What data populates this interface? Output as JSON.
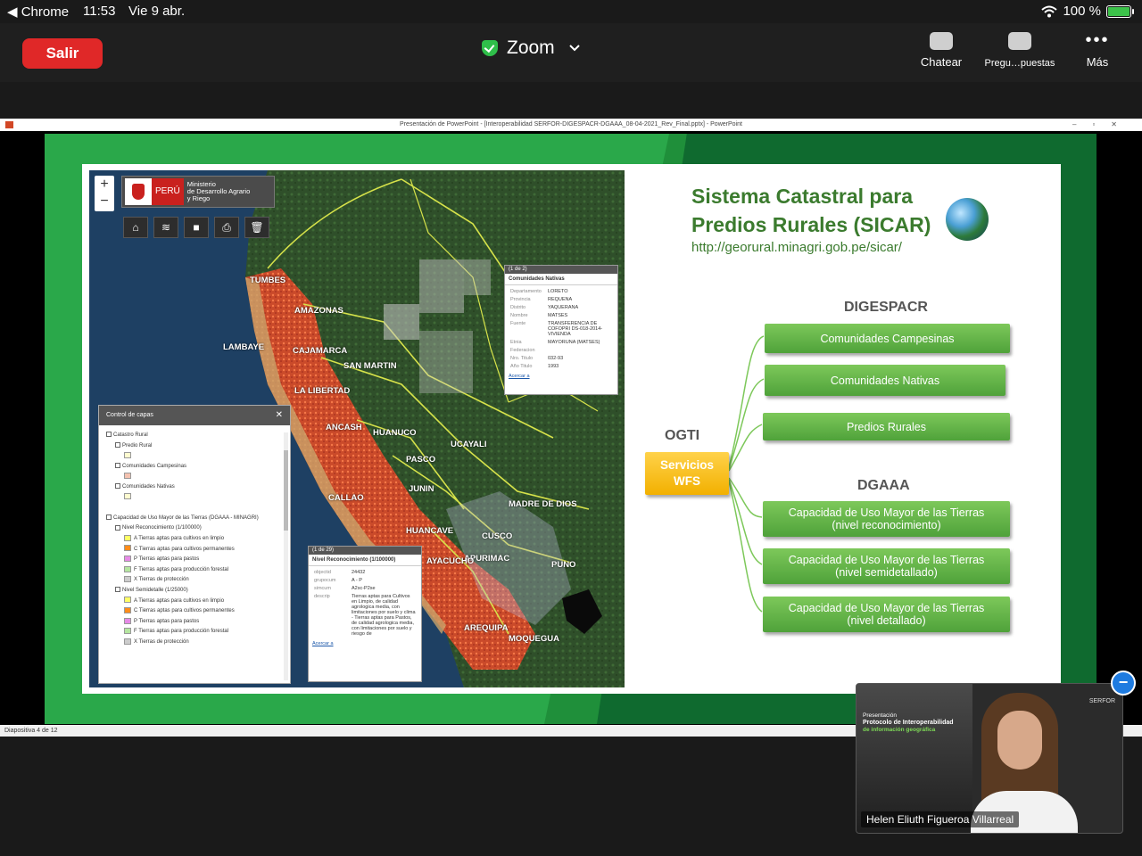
{
  "status_bar": {
    "back_app": "◀ Chrome",
    "time": "11:53",
    "date": "Vie 9 abr.",
    "wifi_icon": "wifi-icon",
    "battery": "100 %",
    "battery_level": 100
  },
  "zoom_bar": {
    "leave_label": "Salir",
    "title": "Zoom",
    "chat_label": "Chatear",
    "qa_label": "Pregu…puestas",
    "more_label": "Más"
  },
  "powerpoint": {
    "window_title": "Presentación de PowerPoint - [Interoperabilidad SERFOR-DIGESPACR-DGAAA_08-04-2021_Rev_Final.pptx] - PowerPoint",
    "status": "Diapositiva 4 de 12"
  },
  "slide": {
    "title_line1": "Sistema Catastral para",
    "title_line2": "Predios Rurales (SICAR)",
    "url": "http://georural.minagri.gob.pe/sicar/",
    "digespacr_label": "DIGESPACR",
    "dgaaa_label": "DGAAA",
    "ogti_label": "OGTI",
    "wfs_line1": "Servicios",
    "wfs_line2": "WFS",
    "digespacr_items": [
      "Comunidades Campesinas",
      "Comunidades Nativas",
      "Predios Rurales"
    ],
    "dgaaa_items": [
      [
        "Capacidad de Uso Mayor de las Tierras",
        "(nivel reconocimiento)"
      ],
      [
        "Capacidad de Uso Mayor de las Tierras",
        "(nivel semidetallado)"
      ],
      [
        "Capacidad de Uso Mayor de las Tierras",
        "(nivel detallado)"
      ]
    ],
    "colors": {
      "green": "#4fa23a",
      "yellow": "#f2b000",
      "title": "#3b7b2e"
    }
  },
  "map": {
    "peru": "PERÚ",
    "ministry": [
      "Ministerio",
      "de Desarrollo Agrario",
      "y Riego"
    ],
    "labels": [
      "TUMBES",
      "LAMBAYE",
      "AMAZONAS",
      "CAJAMARCA",
      "SAN MARTIN",
      "LA LIBERTAD",
      "ANCASH",
      "HUANUCO",
      "UCAYALI",
      "PASCO",
      "JUNIN",
      "CALLAO",
      "MADRE DE DIOS",
      "HUANCAVE",
      "CUSCO",
      "APURIMAC",
      "AYACUCHO",
      "PUNO",
      "AREQUIPA",
      "MOQUEGUA"
    ],
    "popup1": {
      "header": "(1 de 2)",
      "title": "Comunidades Nativas",
      "rows": [
        [
          "Departamento",
          "LORETO"
        ],
        [
          "Provincia",
          "REQUENA"
        ],
        [
          "Distrito",
          "YAQUERANA"
        ],
        [
          "Nombre",
          "MATSES"
        ],
        [
          "Fuente",
          "TRANSFERENCIA DE COFOPRI DS-018-2014-VIVIENDA"
        ],
        [
          "Etnia",
          "MAYORUNA (MATSES)"
        ],
        [
          "Federacion",
          ""
        ],
        [
          "Nro. Titulo",
          "032-93"
        ],
        [
          "Año Titulo",
          "1993"
        ]
      ],
      "link": "Acercar a"
    },
    "popup2": {
      "header": "(1 de 29)",
      "title": "Nivel Reconocimiento (1/100000)",
      "rows": [
        [
          "objectid",
          "24432"
        ],
        [
          "grupocum",
          "A - P"
        ],
        [
          "simcum",
          "A2sc-P2se"
        ],
        [
          "descrip",
          "Tierras aptas para Cultivos en Limpio, de calidad agrologica media, con limitaciones por suelo y clima - Tierras aptas para Pastos, de calidad agrologica media, con limitaciones por suelo y riesgo de"
        ]
      ],
      "link": "Acercar a"
    },
    "layers": {
      "title": "Control de capas",
      "rows": [
        {
          "indent": 0,
          "text": "Catastro Rural",
          "sw": ""
        },
        {
          "indent": 1,
          "text": "Predio Rural",
          "sw": ""
        },
        {
          "indent": 2,
          "text": "",
          "sw": "#fffbd0"
        },
        {
          "indent": 1,
          "text": "Comunidades Campesinas",
          "sw": ""
        },
        {
          "indent": 2,
          "text": "",
          "sw": "#f4c2b0"
        },
        {
          "indent": 1,
          "text": "Comunidades Nativas",
          "sw": ""
        },
        {
          "indent": 2,
          "text": "",
          "sw": "#fffbd0"
        },
        {
          "indent": 0,
          "text": "",
          "sw": ""
        },
        {
          "indent": 0,
          "text": "Capacidad de Uso Mayor de las Tierras (DGAAA - MINAGRI)",
          "sw": ""
        },
        {
          "indent": 1,
          "text": "Nivel Reconocimiento (1/100000)",
          "sw": ""
        },
        {
          "indent": 2,
          "text": "A   Tierras aptas para cultivos en limpio",
          "sw": "#ffff66"
        },
        {
          "indent": 2,
          "text": "C   Tierras aptas para cultivos permanentes",
          "sw": "#ff8c1a"
        },
        {
          "indent": 2,
          "text": "P   Tierras aptas para pastos",
          "sw": "#e68ae6"
        },
        {
          "indent": 2,
          "text": "F   Tierras aptas para producción forestal",
          "sw": "#b5e6a0"
        },
        {
          "indent": 2,
          "text": "X   Tierras de protección",
          "sw": "#cccccc"
        },
        {
          "indent": 1,
          "text": "Nivel Semidetalle (1/25000)",
          "sw": ""
        },
        {
          "indent": 2,
          "text": "A   Tierras aptas para cultivos en limpio",
          "sw": "#ffff66"
        },
        {
          "indent": 2,
          "text": "C   Tierras aptas para cultivos permanentes",
          "sw": "#ff8c1a"
        },
        {
          "indent": 2,
          "text": "P   Tierras aptas para pastos",
          "sw": "#e68ae6"
        },
        {
          "indent": 2,
          "text": "F   Tierras aptas para producción forestal",
          "sw": "#b5e6a0"
        },
        {
          "indent": 2,
          "text": "X   Tierras de protección",
          "sw": "#cccccc"
        }
      ]
    }
  },
  "video": {
    "slide_line1": "Presentación",
    "slide_line2": "Protocolo de Interoperabilidad",
    "slide_line3": "de información geográfica",
    "logo": "SERFOR",
    "participant": "Helen Eliuth Figueroa Villarreal"
  }
}
